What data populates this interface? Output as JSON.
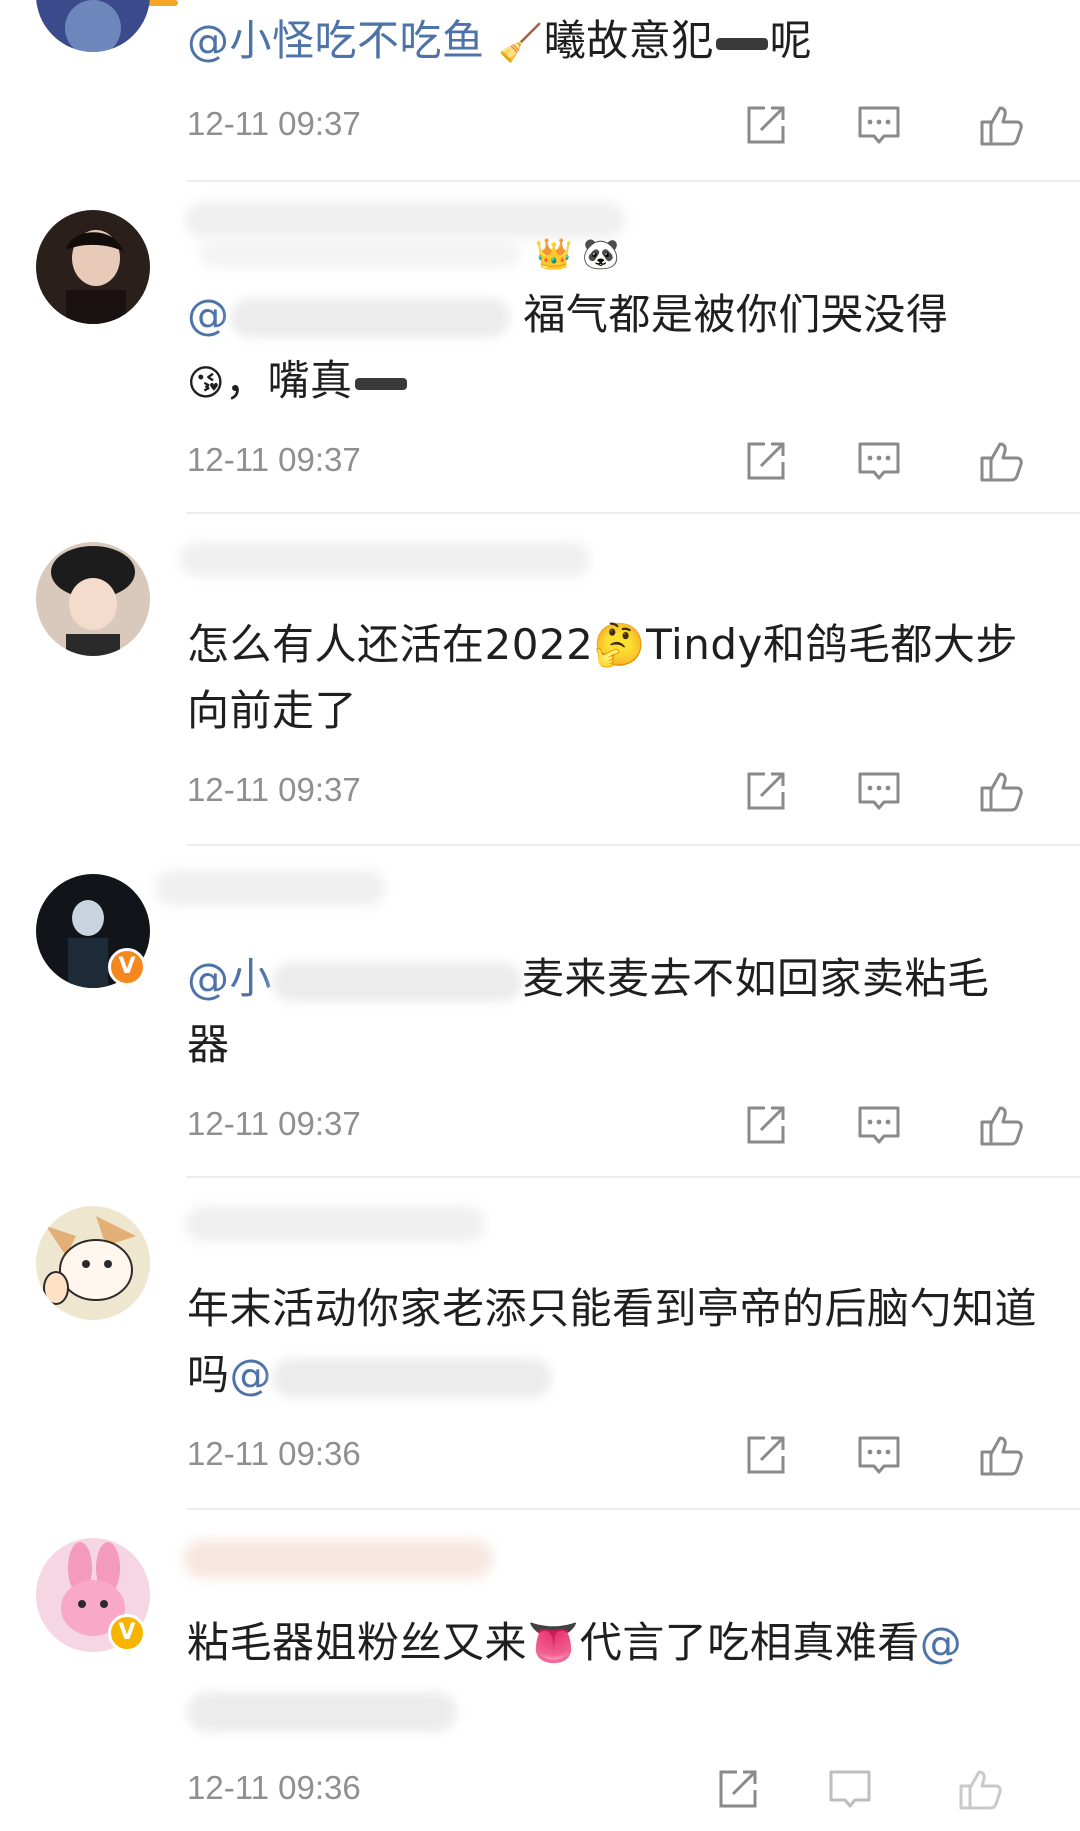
{
  "comments": [
    {
      "name": "",
      "mention": "@小怪吃不吃鱼",
      "text_parts": [
        "🧹",
        "曦故意犯",
        "呢"
      ],
      "time": "12-11 09:37",
      "avatar_color": "#3b4a8a"
    },
    {
      "name": "",
      "mention": "",
      "text_a": "福气都是被你们哭没得",
      "text_b_emoji": "😘",
      "text_b": "，嘴真",
      "time": "12-11 09:37",
      "badges": [
        "👑",
        "🐼"
      ],
      "avatar_color": "#2b1f1c"
    },
    {
      "name": "",
      "text": "怎么有人还活在2022🤔Tindy和鸽毛都大步向前走了",
      "time": "12-11 09:37",
      "avatar_color": "#d9c9bc"
    },
    {
      "name": "",
      "mention": "@小",
      "text": "麦来麦去不如回家卖粘毛器",
      "time": "12-11 09:37",
      "verified": "V",
      "avatar_color": "#111418"
    },
    {
      "name": "",
      "text": "年末活动你家老添只能看到亭帝的后脑勺知道吗",
      "mention": "@",
      "time": "12-11 09:36",
      "avatar_color": "#efe6cf"
    },
    {
      "name": "",
      "text": "粘毛器姐粉丝又来👅代言了吃相真难看",
      "mention": "@",
      "time": "12-11 09:36",
      "verified": "V",
      "avatar_color": "#f6d6e3"
    }
  ],
  "icons": {
    "share": "share-icon",
    "reply": "comment-icon",
    "like": "thumbs-up-icon"
  },
  "colors": {
    "mention": "#4d73a8",
    "time": "#8f8f8f",
    "icon": "#8a8a8a",
    "divider": "#ececec"
  }
}
